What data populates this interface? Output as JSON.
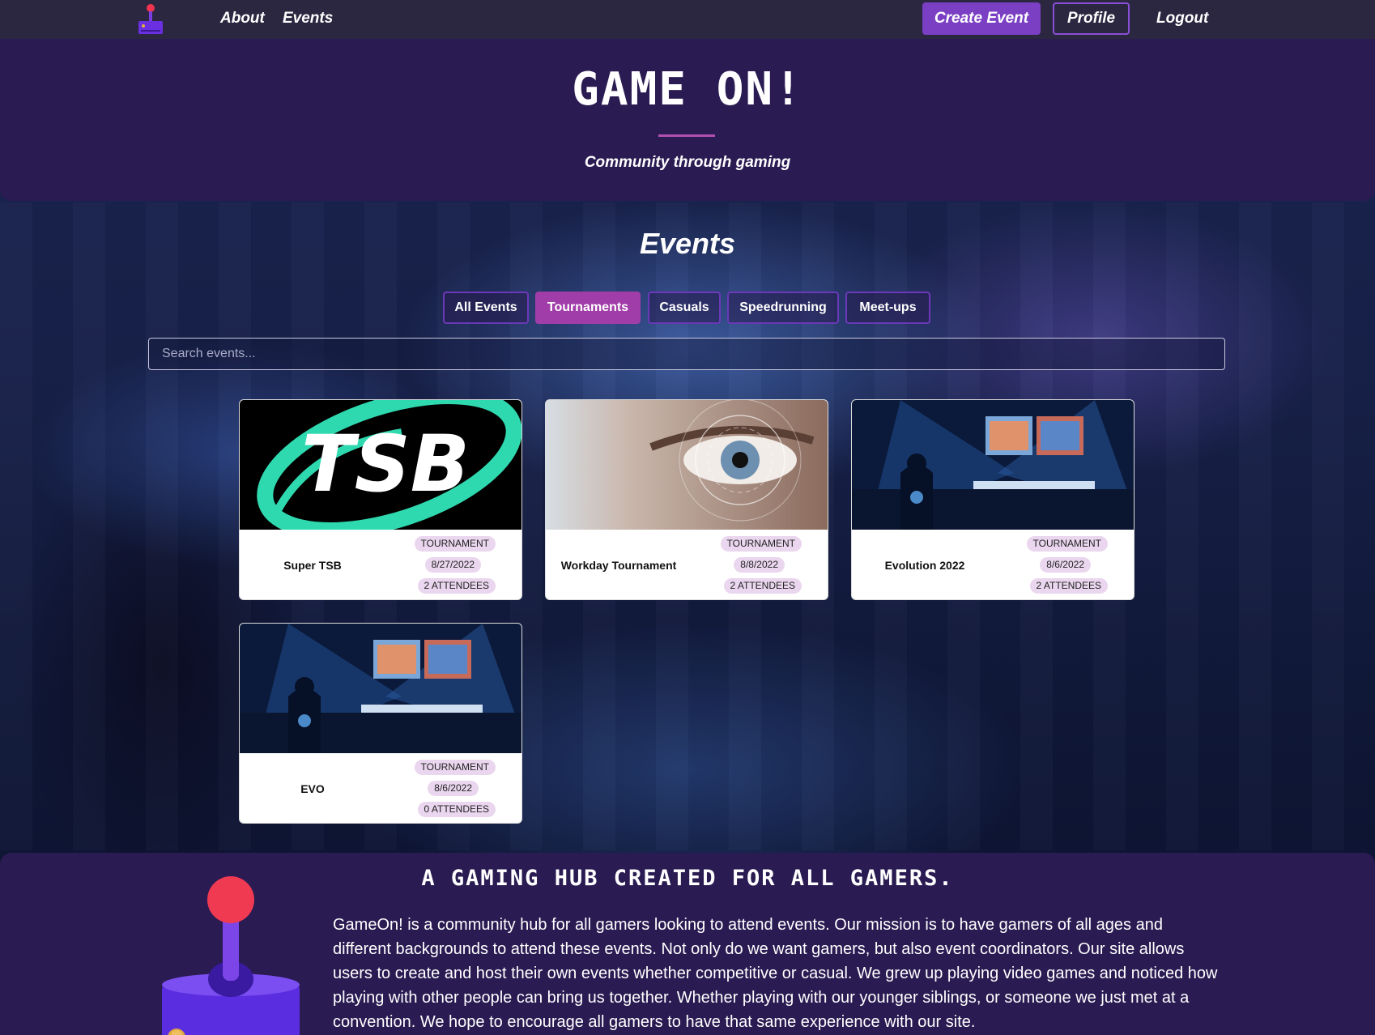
{
  "nav": {
    "about": "About",
    "events": "Events",
    "create_event": "Create Event",
    "profile": "Profile",
    "logout": "Logout"
  },
  "hero": {
    "title": "GAME ON!",
    "subtitle": "Community through gaming"
  },
  "events": {
    "title": "Events",
    "filters": [
      "All Events",
      "Tournaments",
      "Casuals",
      "Speedrunning",
      "Meet-ups"
    ],
    "active_filter": "Tournaments",
    "search_placeholder": "Search events...",
    "cards": [
      {
        "name": "Super TSB",
        "image": "tsb-logo",
        "image_text": "TSB",
        "type": "TOURNAMENT",
        "date": "8/27/2022",
        "attendees": "2 ATTENDEES"
      },
      {
        "name": "Workday Tournament",
        "image": "eye-closeup",
        "type": "TOURNAMENT",
        "date": "8/8/2022",
        "attendees": "2 ATTENDEES"
      },
      {
        "name": "Evolution 2022",
        "image": "arena-stage",
        "type": "TOURNAMENT",
        "date": "8/6/2022",
        "attendees": "2 ATTENDEES"
      },
      {
        "name": "EVO",
        "image": "arena-stage",
        "type": "TOURNAMENT",
        "date": "8/6/2022",
        "attendees": "0 ATTENDEES"
      }
    ]
  },
  "about": {
    "title": "A GAMING HUB CREATED FOR ALL GAMERS.",
    "text": "GameOn! is a community hub for all gamers looking to attend events. Our mission is to have gamers of all ages and different backgrounds to attend these events. Not only do we want gamers, but also event coordinators. Our site allows users to create and host their own events whether competitive or casual. We grew up playing video games and noticed how playing with other people can bring us together. Whether playing with our younger siblings, or someone we just met at a convention. We hope to encourage all gamers to have that same experience with our site."
  },
  "colors": {
    "nav_bg": "#2b2740",
    "hero_bg": "#2a1b52",
    "accent_purple": "#7b3fc4",
    "active_filter": "#a03da8",
    "badge_bg": "#ead6ee"
  }
}
